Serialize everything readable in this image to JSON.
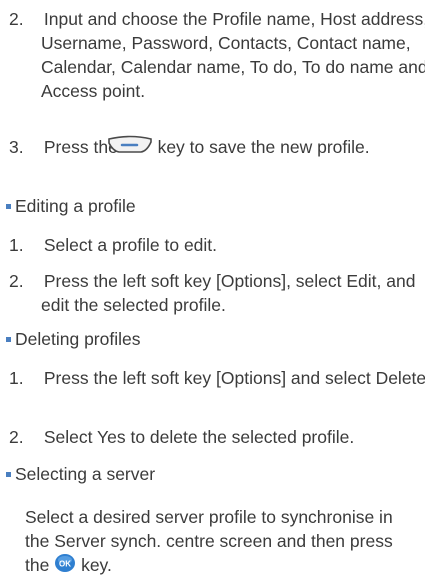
{
  "steps_create": [
    {
      "num": "2.",
      "text": "Input and choose the Profile name, Host address, Username, Password, Contacts, Contact name, Calendar, Calendar name, To do, To do name and Access point."
    },
    {
      "num": "3.",
      "pre": "Press the",
      "icon": "right-soft-key-icon",
      "post": "key to save the new profile."
    }
  ],
  "bullets": {
    "editing": "Editing a profile",
    "deleting": "Deleting profiles",
    "selecting": "Selecting a server"
  },
  "steps_edit": [
    {
      "num": "1.",
      "text": "Select a profile to edit."
    },
    {
      "num": "2.",
      "text": "Press the left soft key [Options], select Edit, and edit the selected profile."
    }
  ],
  "steps_delete": [
    {
      "num": "1.",
      "text": "Press the left soft key [Options] and select Delete."
    },
    {
      "num": "2.",
      "text": "Select Yes to delete the selected profile."
    }
  ],
  "selecting_text": {
    "pre": "Select a desired server profile to synchronise in the Server synch. centre screen and then press the",
    "icon": "ok-key-icon",
    "icon_label": "OK",
    "post": "key."
  },
  "colors": {
    "text": "#3b3b3b",
    "bullet": "#4a7fc0",
    "ok_key": "#2f7fd0"
  }
}
